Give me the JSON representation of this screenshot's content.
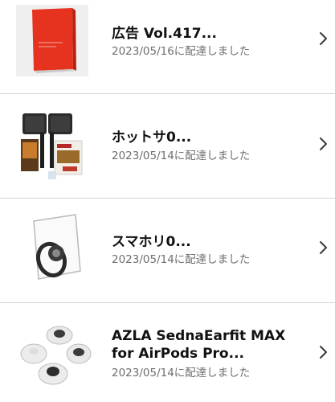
{
  "orders": [
    {
      "title": "広告 Vol.417...",
      "status": "2023/05/16に配達しました",
      "image_icon": "red-magazine-thumbnail"
    },
    {
      "title": "ホットサ0...",
      "status": "2023/05/14に配達しました",
      "image_icon": "hot-sandwich-maker-thumbnail"
    },
    {
      "title": "スマホリ0...",
      "status": "2023/05/14に配達しました",
      "image_icon": "phone-ring-holder-thumbnail"
    },
    {
      "title_line1": "AZLA SednaEarfit MAX",
      "title_line2": "for AirPods Pro...",
      "status": "2023/05/14に配達しました",
      "image_icon": "earbud-tips-thumbnail"
    }
  ],
  "colors": {
    "divider": "#d4d4d4",
    "title": "#111111",
    "status": "#6e6e6e",
    "chevron": "#3a3a3a"
  }
}
